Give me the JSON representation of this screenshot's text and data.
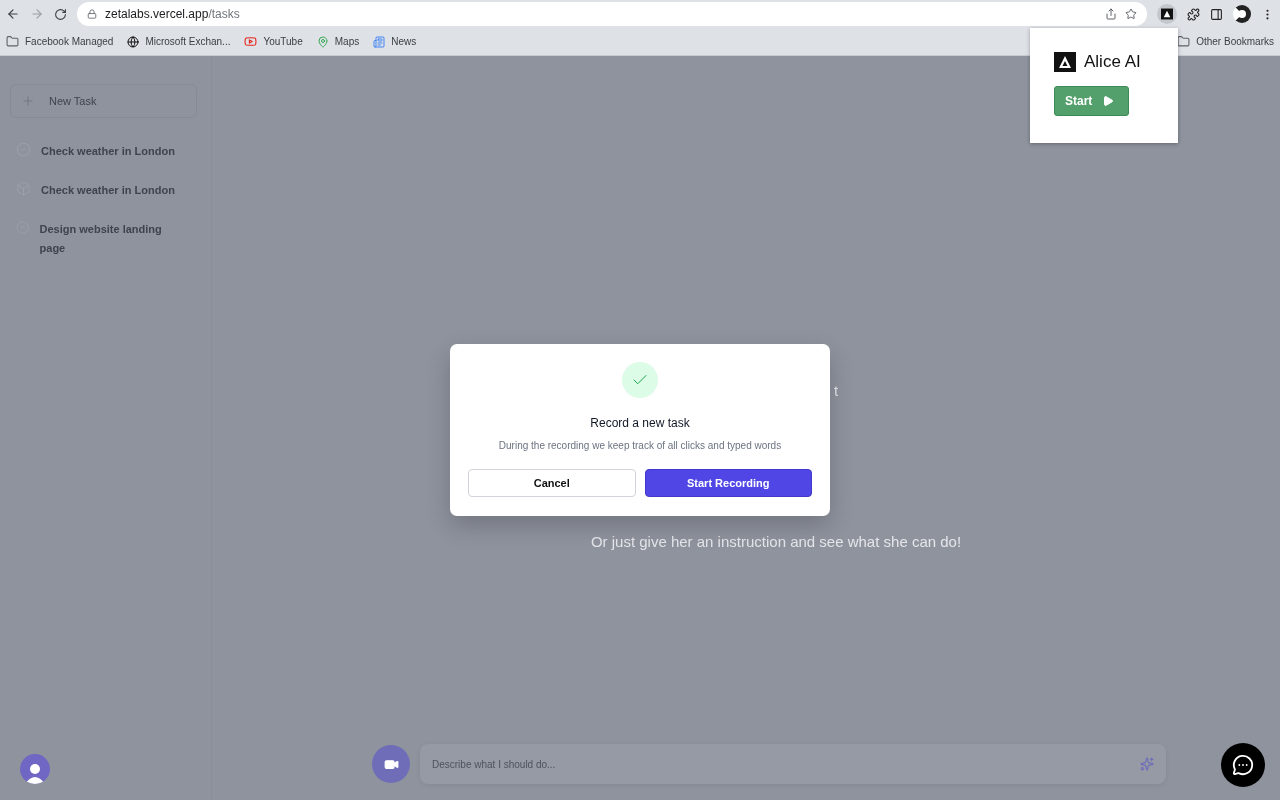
{
  "browser": {
    "url_host": "zetalabs.vercel.app",
    "url_path": "/tasks",
    "bookmarks": [
      {
        "label": "Facebook Managed",
        "kind": "folder"
      },
      {
        "label": "Microsoft Exchan...",
        "kind": "globe"
      },
      {
        "label": "YouTube",
        "kind": "youtube"
      },
      {
        "label": "Maps",
        "kind": "maps"
      },
      {
        "label": "News",
        "kind": "news"
      }
    ],
    "other_bookmarks": "Other Bookmarks"
  },
  "extension_popup": {
    "title": "Alice AI",
    "button": "Start"
  },
  "sidebar": {
    "new_task": "New Task",
    "tasks": [
      {
        "label": "Check weather in London",
        "kind": "done"
      },
      {
        "label": "Check weather in London",
        "kind": "pending"
      },
      {
        "label": "Design website landing page",
        "kind": "cancelled"
      }
    ]
  },
  "main": {
    "covered_text": "t",
    "hint": "Or just give her an instruction and see what she can do!",
    "input_placeholder": "Describe what I should do..."
  },
  "modal": {
    "title": "Record a new task",
    "description": "During the recording we keep track of all clicks and typed words",
    "cancel": "Cancel",
    "confirm": "Start Recording"
  }
}
